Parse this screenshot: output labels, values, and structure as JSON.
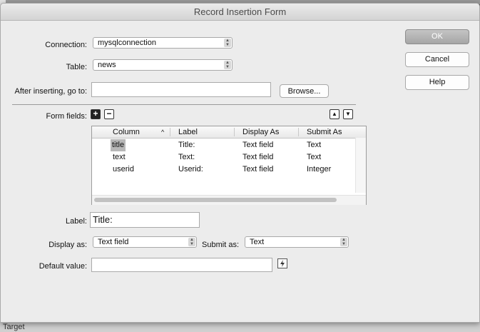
{
  "dialog": {
    "title": "Record Insertion Form"
  },
  "connection": {
    "label": "Connection:",
    "value": "mysqlconnection"
  },
  "table_select": {
    "label": "Table:",
    "value": "news"
  },
  "after_insert": {
    "label": "After inserting, go to:",
    "value": "",
    "browse_label": "Browse..."
  },
  "buttons": {
    "ok": "OK",
    "cancel": "Cancel",
    "help": "Help"
  },
  "form_fields": {
    "label": "Form fields:",
    "add_symbol": "+",
    "remove_symbol": "−",
    "move_up_symbol": "▲",
    "move_down_symbol": "▼",
    "sort_indicator": "^",
    "columns": [
      "Column",
      "Label",
      "Display As",
      "Submit As"
    ],
    "rows": [
      {
        "column": "title",
        "label": "Title:",
        "display_as": "Text field",
        "submit_as": "Text",
        "selected": true
      },
      {
        "column": "text",
        "label": "Text:",
        "display_as": "Text field",
        "submit_as": "Text",
        "selected": false
      },
      {
        "column": "userid",
        "label": "Userid:",
        "display_as": "Text field",
        "submit_as": "Integer",
        "selected": false
      }
    ]
  },
  "field_label": {
    "label": "Label:",
    "value": "Title:"
  },
  "display_as": {
    "label": "Display as:",
    "value": "Text field"
  },
  "submit_as": {
    "label": "Submit as:",
    "value": "Text"
  },
  "default_value": {
    "label": "Default value:",
    "value": ""
  },
  "background": {
    "partial_text": "Target"
  }
}
